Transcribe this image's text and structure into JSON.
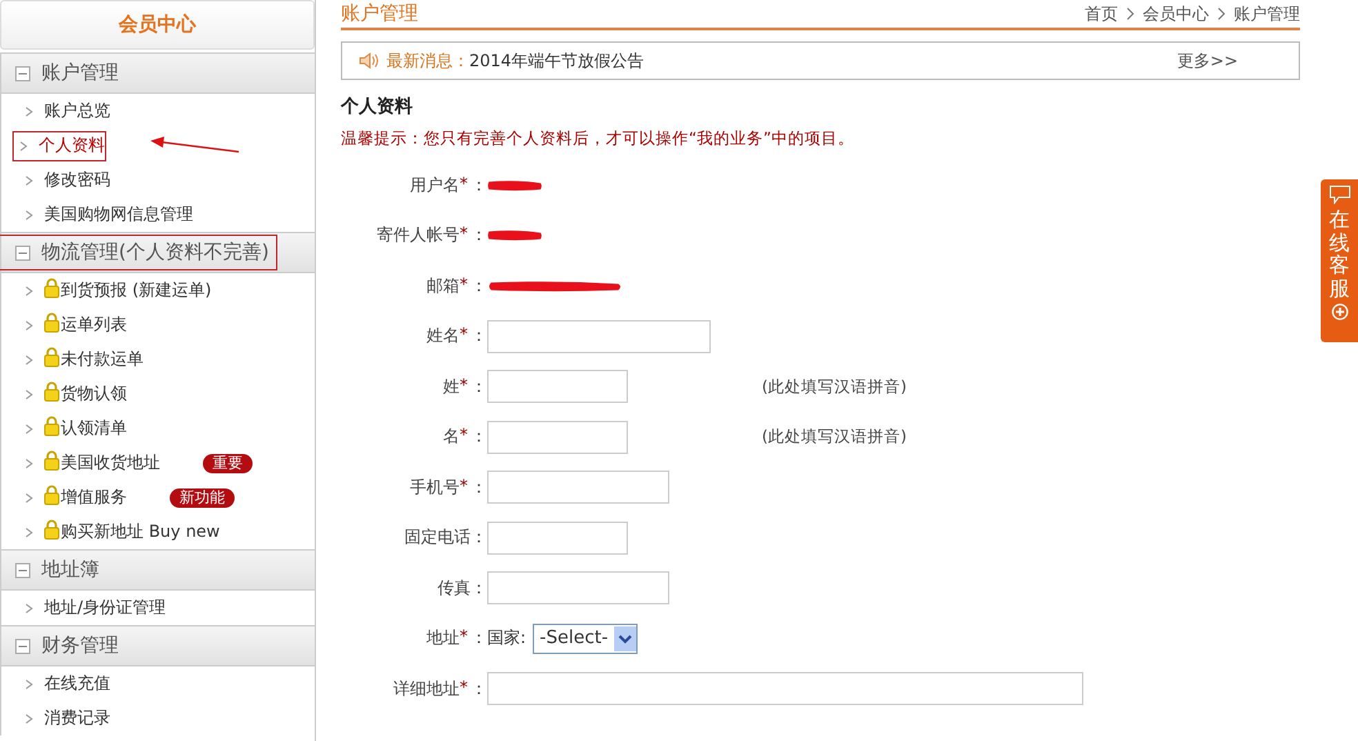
{
  "sidebar": {
    "title": "会员中心",
    "sections": [
      {
        "title": "账户管理",
        "expanded": true,
        "highlighted": false,
        "items": [
          {
            "label": "账户总览",
            "locked": false,
            "highlighted": false,
            "selected": false
          },
          {
            "label": "个人资料",
            "locked": false,
            "highlighted": true,
            "selected": true
          },
          {
            "label": "修改密码",
            "locked": false,
            "highlighted": false,
            "selected": false
          },
          {
            "label": "美国购物网信息管理",
            "locked": false,
            "highlighted": false,
            "selected": false
          }
        ]
      },
      {
        "title": "物流管理(个人资料不完善)",
        "expanded": true,
        "highlighted": true,
        "items": [
          {
            "label": "到货预报 (新建运单)",
            "locked": true,
            "highlighted": false,
            "selected": false
          },
          {
            "label": "运单列表",
            "locked": true,
            "highlighted": false,
            "selected": false
          },
          {
            "label": "未付款运单",
            "locked": true,
            "highlighted": false,
            "selected": false
          },
          {
            "label": "货物认领",
            "locked": true,
            "highlighted": false,
            "selected": false
          },
          {
            "label": "认领清单",
            "locked": true,
            "highlighted": false,
            "selected": false
          },
          {
            "label": "美国收货地址",
            "locked": true,
            "highlighted": false,
            "selected": false,
            "badge": "重要"
          },
          {
            "label": "增值服务",
            "locked": true,
            "highlighted": false,
            "selected": false,
            "badge": "新功能"
          },
          {
            "label": "购买新地址 Buy new",
            "locked": true,
            "highlighted": false,
            "selected": false
          }
        ]
      },
      {
        "title": "地址簿",
        "expanded": true,
        "highlighted": false,
        "items": [
          {
            "label": "地址/身份证管理",
            "locked": false,
            "highlighted": false,
            "selected": false
          }
        ]
      },
      {
        "title": "财务管理",
        "expanded": true,
        "highlighted": false,
        "items": [
          {
            "label": "在线充值",
            "locked": false,
            "highlighted": false,
            "selected": false
          },
          {
            "label": "消费记录",
            "locked": false,
            "highlighted": false,
            "selected": false
          }
        ]
      }
    ]
  },
  "header": {
    "title": "账户管理",
    "breadcrumb": [
      "首页",
      "会员中心",
      "账户管理"
    ]
  },
  "news": {
    "label": "最新消息：",
    "text": "2014年端午节放假公告",
    "more": "更多>>"
  },
  "section_title": "个人资料",
  "notice": "温馨提示：您只有完善个人资料后，才可以操作“我的业务”中的项目。",
  "form": [
    {
      "label": "用户名",
      "required_mark": "*",
      "colon": "：",
      "kind": "redacted"
    },
    {
      "label": "寄件人帐号",
      "required_mark": "*",
      "colon": "：",
      "kind": "redacted"
    },
    {
      "label": "邮箱",
      "required_mark": "*",
      "colon": "：",
      "kind": "redacted"
    },
    {
      "label": "姓名",
      "required_mark": "*",
      "colon": "：",
      "kind": "input"
    },
    {
      "label": "姓",
      "required_mark": "*",
      "colon": "：",
      "kind": "input",
      "hint": "(此处填写汉语拼音)"
    },
    {
      "label": "名",
      "required_mark": "*",
      "colon": "：",
      "kind": "input",
      "hint": "(此处填写汉语拼音)"
    },
    {
      "label": "手机号",
      "required_mark": "*",
      "colon": "：",
      "kind": "input"
    },
    {
      "label": "固定电话",
      "colon": "：",
      "kind": "input"
    },
    {
      "label": "传真",
      "colon": "：",
      "kind": "input"
    },
    {
      "label": "地址",
      "required_mark": "*",
      "colon": "：",
      "kind": "select",
      "prefix": "国家:",
      "value": "-Select-"
    },
    {
      "label": "详细地址",
      "required_mark": "*",
      "colon": "：",
      "kind": "input"
    }
  ],
  "side_tab": {
    "label": "在线客服"
  }
}
